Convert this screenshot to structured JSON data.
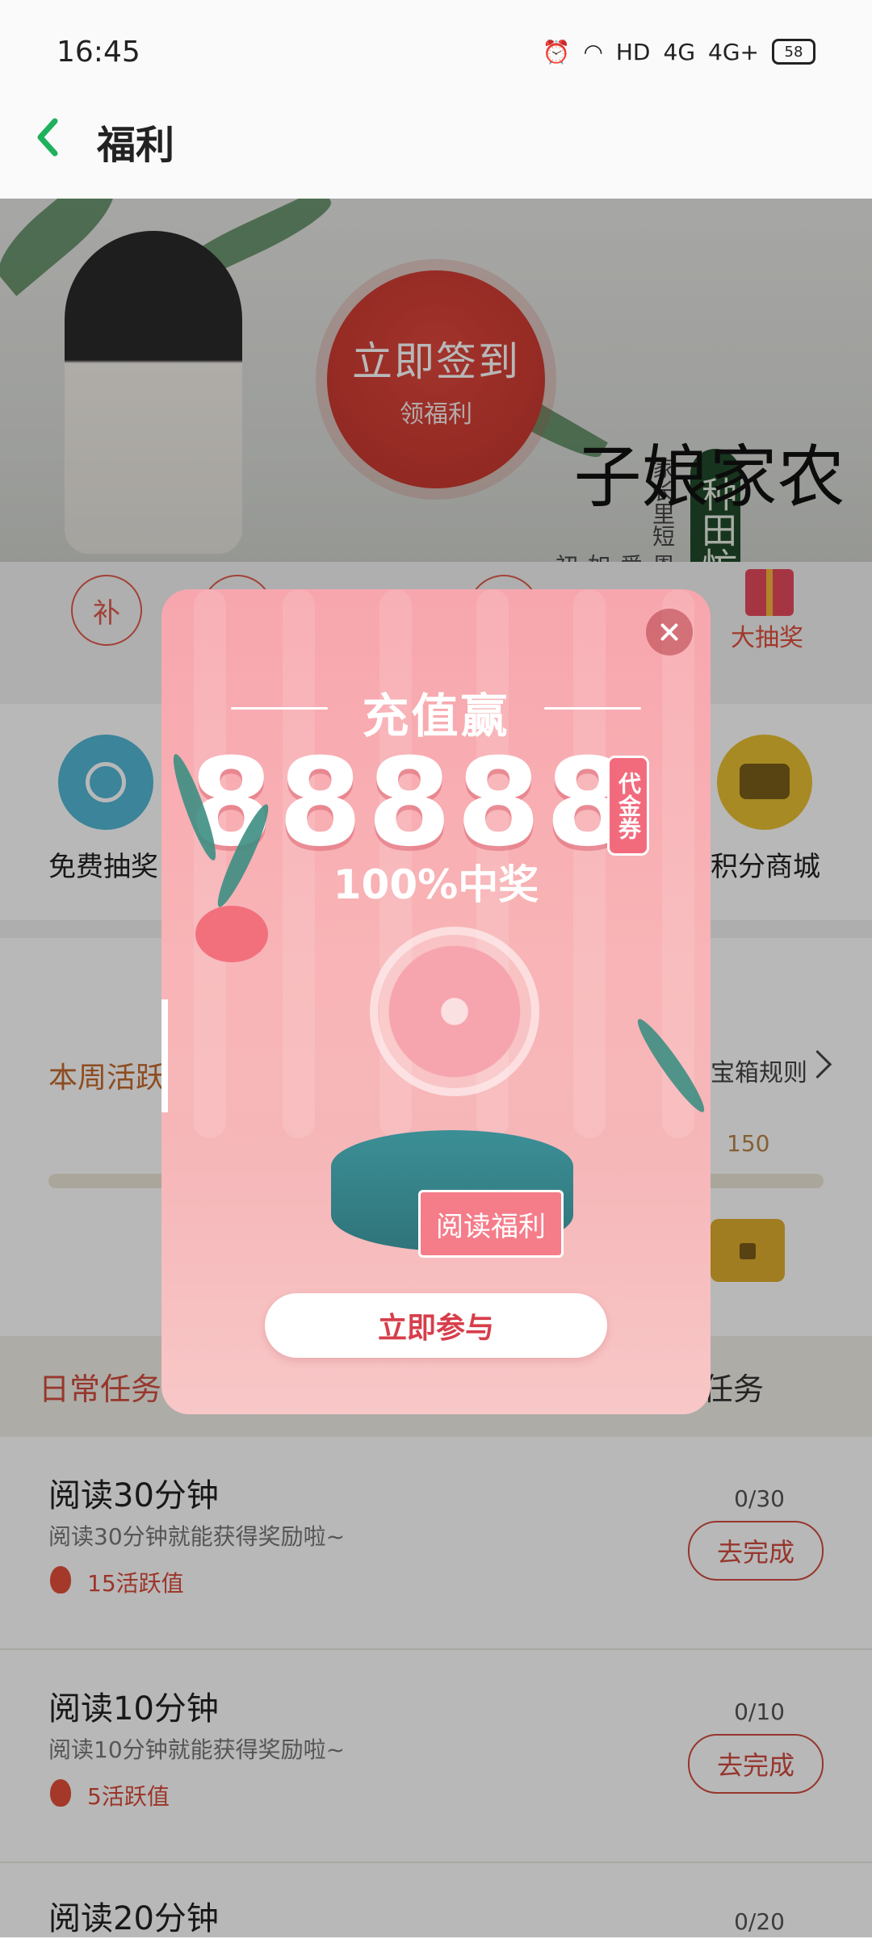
{
  "status_bar": {
    "time": "16:45",
    "network_label": "HD",
    "signal_1": "4G",
    "signal_2": "4G+",
    "battery": "58"
  },
  "header": {
    "title": "福利"
  },
  "banner": {
    "sign_in_label": "立即签到",
    "sign_in_sub": "领福利",
    "book_title": "农家娘子",
    "book_tag": "种田忙",
    "book_subtitle_1": "家长里短",
    "book_subtitle_2": "恩爱如初"
  },
  "feature_row": {
    "buqian_label": "补",
    "lottery_label": "大抽奖"
  },
  "icons": {
    "free_lottery": "免费抽奖",
    "points_mall": "积分商城"
  },
  "weekly": {
    "title": "本周活跃",
    "rules": "宝箱规则",
    "milestone_value": "150"
  },
  "tabs": {
    "daily": "日常任务",
    "other": "任务"
  },
  "tasks": [
    {
      "title": "阅读30分钟",
      "desc": "阅读30分钟就能获得奖励啦~",
      "reward": "15活跃值",
      "count": "0/30",
      "button": "去完成"
    },
    {
      "title": "阅读10分钟",
      "desc": "阅读10分钟就能获得奖励啦~",
      "reward": "5活跃值",
      "count": "0/10",
      "button": "去完成"
    },
    {
      "title": "阅读20分钟",
      "count": "0/20"
    }
  ],
  "modal": {
    "headline": "充值赢",
    "amount": "88888",
    "badge": "代金券",
    "subline": "100%中奖",
    "coupon_tag": "代金券",
    "fan_sign": "阅读福利",
    "cta": "立即参与"
  },
  "colors": {
    "accent": "#d14d3f",
    "back_arrow": "#1fb15c",
    "modal_pink": "#f7a6ad"
  }
}
